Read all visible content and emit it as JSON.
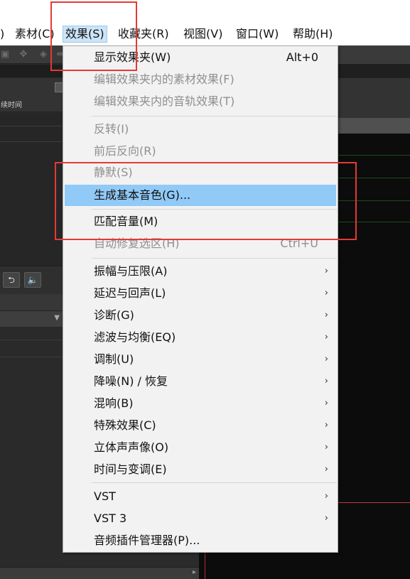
{
  "menubar": {
    "items": [
      {
        "label": ")",
        "name": "menu-partial"
      },
      {
        "label": "素材(C)",
        "name": "menu-clip"
      },
      {
        "label": "效果(S)",
        "name": "menu-effects"
      },
      {
        "label": "收藏夹(R)",
        "name": "menu-favorites"
      },
      {
        "label": "视图(V)",
        "name": "menu-view"
      },
      {
        "label": "窗口(W)",
        "name": "menu-window"
      },
      {
        "label": "帮助(H)",
        "name": "menu-help"
      }
    ]
  },
  "left_panel": {
    "column_header": "续时间"
  },
  "effects_menu": {
    "items": [
      {
        "label": "显示效果夹(W)",
        "shortcut": "Alt+0",
        "enabled": true
      },
      {
        "label": "编辑效果夹内的素材效果(F)",
        "enabled": false
      },
      {
        "label": "编辑效果夹内的音轨效果(T)",
        "enabled": false
      },
      {
        "label": "反转(I)",
        "enabled": false
      },
      {
        "label": "前后反向(R)",
        "enabled": false
      },
      {
        "label": "静默(S)",
        "enabled": false
      },
      {
        "label": "生成基本音色(G)...",
        "enabled": true,
        "highlighted": true
      },
      {
        "label": "匹配音量(M)",
        "enabled": true
      },
      {
        "label": "自动修复选区(H)",
        "shortcut": "Ctrl+U",
        "enabled": false
      },
      {
        "label": "振幅与压限(A)",
        "submenu": true
      },
      {
        "label": "延迟与回声(L)",
        "submenu": true
      },
      {
        "label": "诊断(G)",
        "submenu": true
      },
      {
        "label": "滤波与均衡(EQ)",
        "submenu": true
      },
      {
        "label": "调制(U)",
        "submenu": true
      },
      {
        "label": "降噪(N) / 恢复",
        "submenu": true
      },
      {
        "label": "混响(B)",
        "submenu": true
      },
      {
        "label": "特殊效果(C)",
        "submenu": true
      },
      {
        "label": "立体声声像(O)",
        "submenu": true
      },
      {
        "label": "时间与变调(E)",
        "submenu": true
      },
      {
        "label": "VST",
        "submenu": true
      },
      {
        "label": "VST 3",
        "submenu": true
      },
      {
        "label": "音频插件管理器(P)..."
      }
    ]
  },
  "icons": {
    "submenu_arrow": "›",
    "dropdown_arrow": "▼"
  },
  "colors": {
    "menu_highlight": "#91c9f7",
    "annotation": "#e53935",
    "menubar_active": "#cce4f7"
  }
}
